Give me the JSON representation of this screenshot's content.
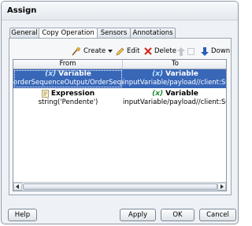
{
  "dialog": {
    "title": "Assign"
  },
  "tabs": [
    {
      "label": "General"
    },
    {
      "label": "Copy Operation"
    },
    {
      "label": "Sensors"
    },
    {
      "label": "Annotations"
    }
  ],
  "toolbar": {
    "create_label": "Create",
    "edit_label": "Edit",
    "delete_label": "Delete",
    "down_label": "Down"
  },
  "table": {
    "columns": [
      "From",
      "To"
    ],
    "rows": [
      {
        "from_type": "Variable",
        "from_value": "orderSequenceOutput/OrderSeque...",
        "to_type": "Variable",
        "to_value": "inputVariable/payload//client:SOAO..."
      },
      {
        "from_type": "Expression",
        "from_value": "string('Pendente')",
        "to_type": "Variable",
        "to_value": "inputVariable/payload//client:SOAO..."
      }
    ]
  },
  "footer": {
    "help_label": "Help",
    "apply_label": "Apply",
    "ok_label": "OK",
    "cancel_label": "Cancel"
  },
  "icons": {
    "variable_symbol": "(x)"
  },
  "colors": {
    "selection": "#3867b8",
    "delete": "#d22b1f",
    "down_arrow": "#2c5fb8"
  }
}
